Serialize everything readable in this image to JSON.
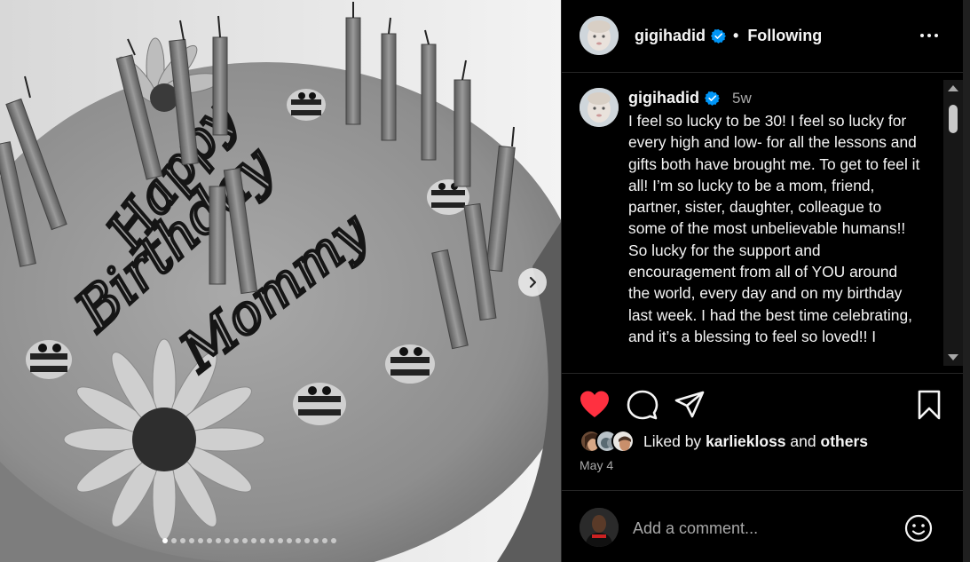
{
  "post": {
    "username": "gigihadid",
    "separator": "•",
    "follow_state": "Following",
    "time_ago": "5w",
    "caption": "I feel so lucky to be 30! I feel so lucky for every high and low- for all the lessons and gifts both have brought me. To get to feel it all! I’m so lucky to be a mom, friend, partner, sister, daughter, colleague to some of the most unbelievable humans!! So lucky for the support and encouragement from all of YOU around the world, every day and on my birthday last week. I had the best time celebrating, and it’s a blessing to feel so loved!! I",
    "liked_by_prefix": "Liked by",
    "liked_by_user": "karliekloss",
    "liked_by_and": "and",
    "liked_by_suffix": "others",
    "date": "May 4"
  },
  "cake_text": {
    "line1": "Happy",
    "line2": "Birthday",
    "line3": "Mommy"
  },
  "comment": {
    "placeholder": "Add a comment..."
  },
  "carousel": {
    "total_slides": 20,
    "current_slide": 1
  },
  "icons": {
    "like": "heart-icon",
    "comment": "comment-icon",
    "share": "share-icon",
    "save": "bookmark-icon",
    "more": "more-options-icon",
    "next": "chevron-right-icon",
    "emoji": "emoji-icon",
    "verified": "verified-badge-icon"
  },
  "colors": {
    "like_red": "#ff3040",
    "verified_blue": "#0095f6",
    "background": "#000000",
    "text_primary": "#f5f5f5",
    "text_secondary": "#a8a8a8"
  }
}
